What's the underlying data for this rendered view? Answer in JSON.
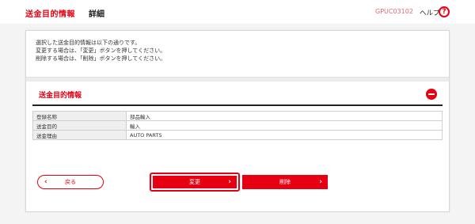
{
  "header": {
    "title": "送金目的情報",
    "subtitle": "詳細",
    "screen_id": "GPUC03102",
    "help_label": "ヘルプ",
    "help_icon": "?"
  },
  "intro": {
    "lines": [
      "選択した送金目的情報は以下の通りです。",
      "変更する場合は、「変更」ボタンを押してください。",
      "削除する場合は、「削除」ボタンを押してください。"
    ]
  },
  "section": {
    "title": "送金目的情報",
    "collapse_icon": "minus-circle-icon",
    "rows": [
      {
        "label": "登録名称",
        "value": "部品輸入"
      },
      {
        "label": "送金目的",
        "value": "輸入"
      },
      {
        "label": "送金理由",
        "value": "AUTO PARTS"
      }
    ]
  },
  "buttons": {
    "back_label": "戻る",
    "change_label": "変更",
    "delete_label": "削除"
  },
  "colors": {
    "accent": "#e60012",
    "label_bg": "#efefef"
  }
}
